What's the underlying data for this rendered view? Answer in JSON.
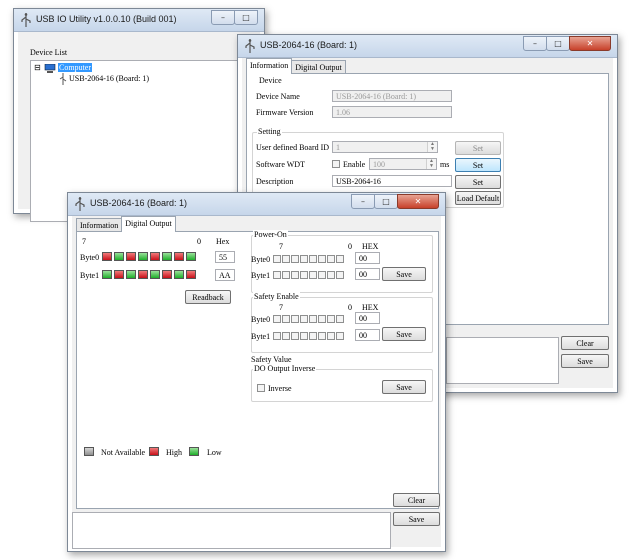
{
  "main_window": {
    "title": "USB IO Utility    v1.0.0.10 (Build 001)",
    "device_list_label": "Device List",
    "tree": {
      "expander": "⊟",
      "root": "Computer",
      "child": "USB-2064-16 (Board: 1)"
    }
  },
  "window_controls": {
    "minimize": "–",
    "maximize": "□",
    "close": "✕"
  },
  "board_window": {
    "title": "USB-2064-16 (Board: 1)",
    "tabs": [
      "Information",
      "Digital Output"
    ],
    "device_group": {
      "title": "Device",
      "name_label": "Device Name",
      "name_value": "USB-2064-16 (Board: 1)",
      "fw_label": "Firmware Version",
      "fw_value": "1.06"
    },
    "setting_group": {
      "title": "Setting",
      "board_id_label": "User defined Board ID",
      "board_id_value": "1",
      "wdt_label": "Software WDT",
      "enable_label": "Enable",
      "wdt_value": "100",
      "wdt_unit": "ms",
      "desc_label": "Description",
      "desc_value": "USB-2064-16",
      "set_label": "Set",
      "load_default_label": "Load Default"
    },
    "clear_label": "Clear",
    "save_label": "Save"
  },
  "do_window": {
    "title": "USB-2064-16 (Board: 1)",
    "tabs": [
      "Information",
      "Digital Output"
    ],
    "bit_high": "7",
    "bit_low": "0",
    "hex_label": "Hex",
    "hex_label_upper": "HEX",
    "byte0_label": "Byte0",
    "byte1_label": "Byte1",
    "byte0_hex": "55",
    "byte1_hex": "AA",
    "byte0_leds": [
      "red",
      "green",
      "red",
      "green",
      "red",
      "green",
      "red",
      "green"
    ],
    "byte1_leds": [
      "green",
      "red",
      "green",
      "red",
      "green",
      "red",
      "green",
      "red"
    ],
    "readback_label": "Readback",
    "power_on": {
      "title": "Power-On",
      "byte0_hex": "00",
      "byte1_hex": "00",
      "save_label": "Save"
    },
    "safety_enable": {
      "title": "Safety Enable",
      "byte0_hex": "00",
      "byte1_hex": "00",
      "save_label": "Save"
    },
    "safety_value_label": "Safety Value",
    "do_output_inverse": {
      "title": "DO Output Inverse",
      "inverse_label": "Inverse",
      "save_label": "Save"
    },
    "legend": {
      "not_available": "Not Available",
      "high": "High",
      "low": "Low"
    },
    "clear_label": "Clear",
    "save_label": "Save",
    "led_colors": {
      "high": "#c8101a",
      "low": "#1fae2a",
      "not_available": "#8e8e8e"
    }
  }
}
